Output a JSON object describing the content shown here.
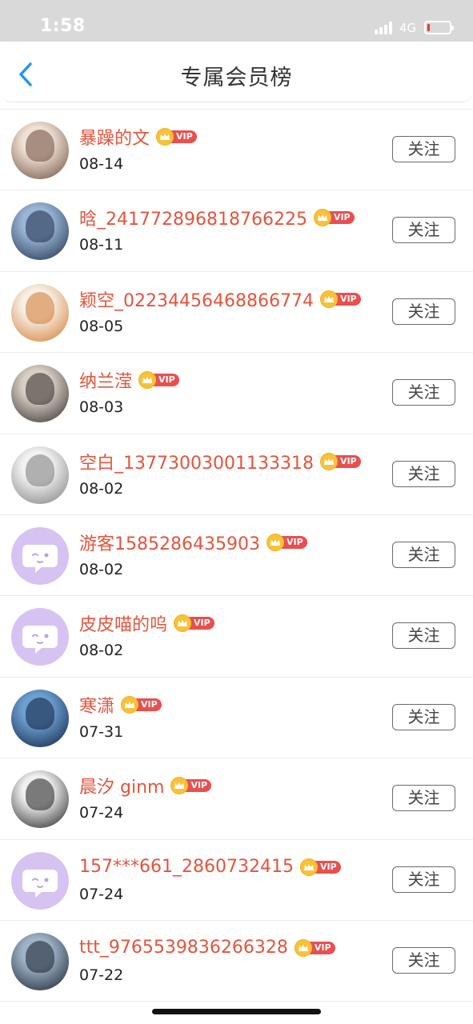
{
  "status_bar": {
    "time": "1:58",
    "network": "4G",
    "battery_color": "#e53935"
  },
  "nav": {
    "title": "专属会员榜",
    "back_icon": "chevron-left-icon"
  },
  "colors": {
    "name": "#e5543c",
    "vip_tag": "#e94f4f",
    "crown": "#f7c23a",
    "guest_avatar": "#d6c3f2",
    "accent": "#2196f3"
  },
  "vip_label": "VIP",
  "follow_label": "关注",
  "members": [
    {
      "name": "暴躁的文",
      "date": "08-14",
      "avatar": "photo",
      "avatar_tone": [
        "#f0e1d4",
        "#6b4a3a"
      ]
    },
    {
      "name": "晗_241772896818766225",
      "date": "08-11",
      "avatar": "photo",
      "avatar_tone": [
        "#9ab6d6",
        "#1c2a48"
      ]
    },
    {
      "name": "颖空_02234456468866774",
      "date": "08-05",
      "avatar": "photo",
      "avatar_tone": [
        "#f7f0e6",
        "#d2772e"
      ]
    },
    {
      "name": "纳兰滢",
      "date": "08-03",
      "avatar": "photo",
      "avatar_tone": [
        "#d9d0c5",
        "#2e2826"
      ]
    },
    {
      "name": "空白_13773003001133318",
      "date": "08-02",
      "avatar": "photo",
      "avatar_tone": [
        "#f2f2f2",
        "#7a7a7a"
      ]
    },
    {
      "name": "游客1585286435903",
      "date": "08-02",
      "avatar": "guest",
      "avatar_tone": [
        "#d6c3f2",
        "#ffffff"
      ]
    },
    {
      "name": "皮皮喵的呜",
      "date": "08-02",
      "avatar": "guest",
      "avatar_tone": [
        "#d6c3f2",
        "#ffffff"
      ]
    },
    {
      "name": "寒潇",
      "date": "07-31",
      "avatar": "photo",
      "avatar_tone": [
        "#6e9fd1",
        "#0c1e3d"
      ]
    },
    {
      "name": "晨汐 ginm",
      "date": "07-24",
      "avatar": "photo",
      "avatar_tone": [
        "#f0f0f0",
        "#1a1a1a"
      ]
    },
    {
      "name": "157***661_2860732415",
      "date": "07-24",
      "avatar": "guest",
      "avatar_tone": [
        "#d6c3f2",
        "#ffffff"
      ]
    },
    {
      "name": "ttt_9765539836266328",
      "date": "07-22",
      "avatar": "photo",
      "avatar_tone": [
        "#9fb3c8",
        "#151d2a"
      ]
    }
  ]
}
